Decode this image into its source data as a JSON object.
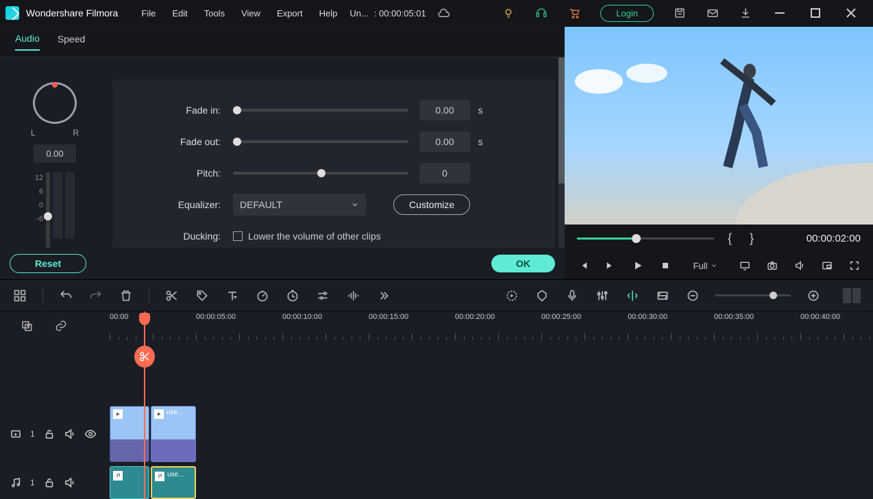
{
  "app": {
    "name": "Wondershare Filmora"
  },
  "menus": [
    "File",
    "Edit",
    "Tools",
    "View",
    "Export",
    "Help"
  ],
  "project": {
    "label": "Un...",
    "time": ": 00:00:05:01"
  },
  "login": "Login",
  "tabs": [
    "Audio",
    "Speed"
  ],
  "audio": {
    "knob_lr": [
      "L",
      "R"
    ],
    "knob_val": "0.00",
    "vu": [
      "12",
      "6",
      "0",
      "-6"
    ],
    "fade_in": {
      "label": "Fade in:",
      "val": "0.00",
      "unit": "s"
    },
    "fade_out": {
      "label": "Fade out:",
      "val": "0.00",
      "unit": "s"
    },
    "pitch": {
      "label": "Pitch:",
      "val": "0"
    },
    "eq": {
      "label": "Equalizer:",
      "val": "DEFAULT",
      "btn": "Customize"
    },
    "duck": {
      "label": "Ducking:",
      "text": "Lower the volume of other clips"
    }
  },
  "buttons": {
    "reset": "Reset",
    "ok": "OK"
  },
  "preview": {
    "timecode": "00:00:02:00",
    "size_sel": "Full"
  },
  "ruler": [
    "00:00",
    "00:00:05:00",
    "00:00:10:00",
    "00:00:15:00",
    "00:00:20:00",
    "00:00:25:00",
    "00:00:30:00",
    "00:00:35:00",
    "00:00:40:00"
  ],
  "tracks": {
    "video": {
      "num": "1",
      "clip2_name": "use..."
    },
    "audio": {
      "num": "1",
      "clip2_name": "use..."
    }
  }
}
